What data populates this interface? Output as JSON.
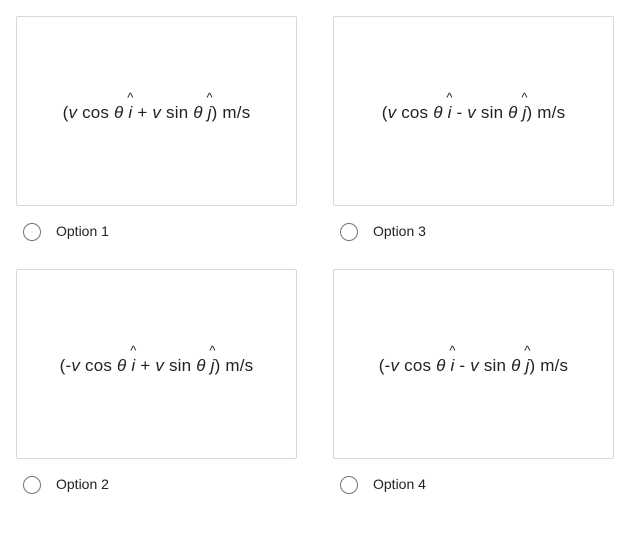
{
  "options": [
    {
      "label": "Option 1",
      "expr_prefix": "(",
      "term1_sign": "",
      "term1_var": "v",
      "term1_fn": " cos ",
      "term1_ang": "θ",
      "term1_unit": "i",
      "op": "  + ",
      "term2_var": "v",
      "term2_fn": " sin ",
      "term2_ang": "θ",
      "term2_unit": "j",
      "expr_suffix": ") m/s"
    },
    {
      "label": "Option 2",
      "expr_prefix": "(-",
      "term1_var": "v",
      "term1_fn": " cos ",
      "term1_ang": "θ",
      "term1_unit": "i",
      "op": "  + ",
      "term2_var": "v",
      "term2_fn": " sin ",
      "term2_ang": "θ",
      "term2_unit": "j",
      "expr_suffix": ") m/s"
    },
    {
      "label": "Option 3",
      "expr_prefix": "(",
      "term1_var": "v",
      "term1_fn": " cos ",
      "term1_ang": "θ",
      "term1_unit": "i",
      "op": "  - ",
      "term2_var": "v",
      "term2_fn": " sin ",
      "term2_ang": "θ",
      "term2_unit": "j",
      "expr_suffix": ") m/s"
    },
    {
      "label": "Option 4",
      "expr_prefix": "(-",
      "term1_var": "v",
      "term1_fn": " cos ",
      "term1_ang": "θ",
      "term1_unit": "i",
      "op": "  - ",
      "term2_var": "v",
      "term2_fn": " sin ",
      "term2_ang": "θ",
      "term2_unit": "j",
      "expr_suffix": ") m/s"
    }
  ]
}
